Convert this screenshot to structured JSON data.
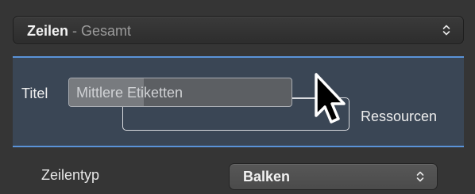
{
  "rows_popup": {
    "main": "Zeilen",
    "separator": " - ",
    "sub": "Gesamt",
    "icon": "stepper-chevrons-icon"
  },
  "title_section": {
    "label": "Titel",
    "field_value": "Mittlere Etiketten",
    "resources_label": "Ressourcen",
    "pointer_icon": "arrow-cursor-icon",
    "accent_color": "#5a93d8"
  },
  "row_type": {
    "label": "Zeilentyp",
    "value": "Balken",
    "icon": "stepper-chevrons-icon"
  }
}
